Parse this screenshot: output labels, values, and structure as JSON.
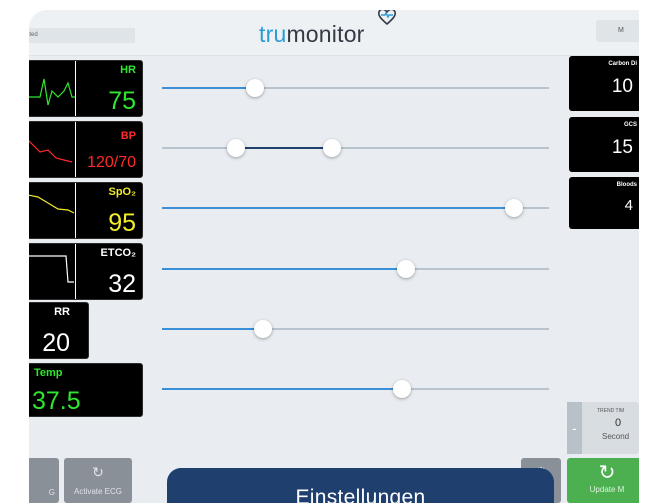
{
  "header": {
    "left_field": "ected",
    "logo_tru": "tru",
    "logo_rest": "monitor",
    "right_button": "M"
  },
  "vitals": [
    {
      "label": "HR",
      "value": "75",
      "color": "#2ee82e"
    },
    {
      "label": "BP",
      "value": "120/70",
      "color": "#ff2a2a"
    },
    {
      "label": "SpO₂",
      "value": "95",
      "color": "#f2ec2a"
    },
    {
      "label": "ETCO₂",
      "value": "32",
      "color": "#ffffff"
    },
    {
      "label": "RR",
      "value": "20",
      "color": "#ffffff"
    },
    {
      "label": "Temp",
      "value": "37.5",
      "color": "#2ee82e"
    }
  ],
  "right_panel": [
    {
      "label": "Carbon Di",
      "value": "10"
    },
    {
      "label": "GCS",
      "value": "15"
    },
    {
      "label": "Bloods",
      "value": "4"
    }
  ],
  "sliders": [
    {
      "name": "hr",
      "level": 0.24
    },
    {
      "name": "bp",
      "low": 0.19,
      "high": 0.44
    },
    {
      "name": "spo2",
      "level": 0.91
    },
    {
      "name": "etco2",
      "level": 0.63
    },
    {
      "name": "rr",
      "level": 0.26
    },
    {
      "name": "temp",
      "level": 0.62
    }
  ],
  "trend": {
    "label": "TREND TIM",
    "value": "0",
    "unit": "Second",
    "minus": "-"
  },
  "bottom": {
    "left_btn": "G",
    "activate_ecg": "Activate ECG",
    "settings": "Einstellungen",
    "update": "Update M"
  },
  "colors": {
    "accent": "#3a8fd9",
    "settings_bg": "#1f3f6e",
    "update_bg": "#4caf50"
  }
}
